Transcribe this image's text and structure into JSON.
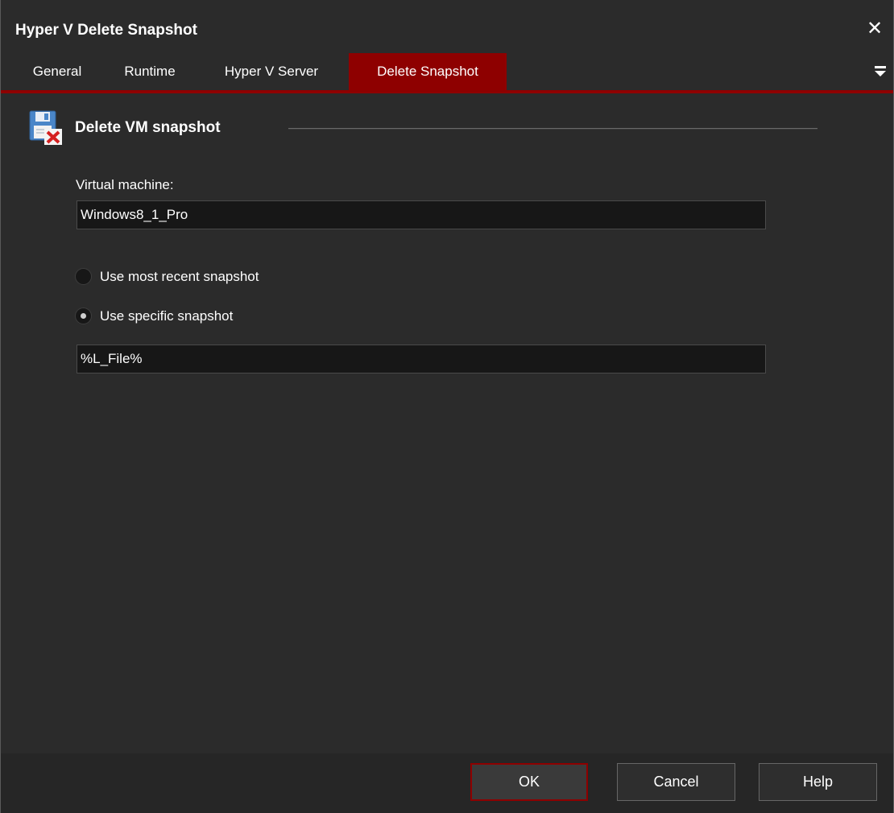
{
  "window": {
    "title": "Hyper V Delete Snapshot",
    "close_symbol": "✕"
  },
  "tabs": [
    {
      "label": "General",
      "active": false
    },
    {
      "label": "Runtime",
      "active": false
    },
    {
      "label": "Hyper V Server",
      "active": false
    },
    {
      "label": "Delete Snapshot",
      "active": true
    }
  ],
  "section": {
    "title": "Delete VM snapshot",
    "icon": "floppy-delete-icon"
  },
  "vm_field": {
    "label": "Virtual machine:",
    "value": "Windows8_1_Pro"
  },
  "options": [
    {
      "label": "Use most recent snapshot",
      "selected": false
    },
    {
      "label": "Use specific snapshot",
      "selected": true
    }
  ],
  "snapshot_field": {
    "value": "%L_File%"
  },
  "buttons": {
    "ok": "OK",
    "cancel": "Cancel",
    "help": "Help"
  },
  "colors": {
    "accent": "#8e0000",
    "background": "#2b2b2b",
    "input_background": "#171717"
  }
}
